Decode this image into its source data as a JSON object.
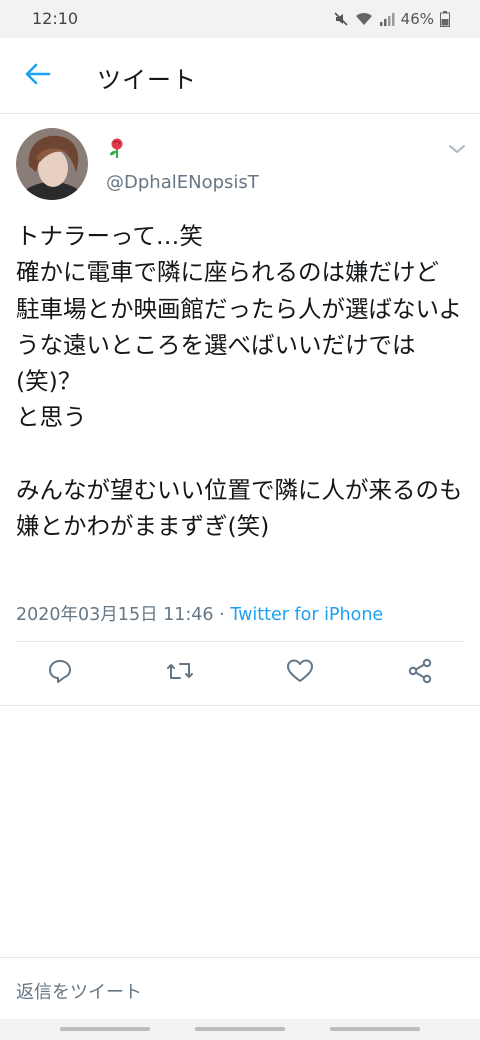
{
  "status_bar": {
    "time": "12:10",
    "battery": "46%",
    "icons": [
      "mute-icon",
      "wifi-icon",
      "signal-icon",
      "battery-icon"
    ]
  },
  "header": {
    "title": "ツイート",
    "back_icon": "arrow-left-icon"
  },
  "tweet": {
    "display_name_icon": "rose-emoji",
    "username": "@DphalENopsisT",
    "text": "トナラーって…笑\n確かに電車で隣に座られるのは嫌だけど\n駐車場とか映画館だったら人が選ばないような遠いところを選べばいいだけでは(笑)？\nと思う\n\nみんなが望むいい位置で隣に人が来るのも嫌とかわがままずぎ(笑)",
    "timestamp": "2020年03月15日 11:46",
    "separator": " · ",
    "source": "Twitter for iPhone"
  },
  "actions": [
    "reply-icon",
    "retweet-icon",
    "like-icon",
    "share-icon"
  ],
  "reply_bar": {
    "placeholder": "返信をツイート"
  },
  "colors": {
    "accent": "#1da1f2",
    "secondary_text": "#657786",
    "divider": "#e1e6ea"
  }
}
